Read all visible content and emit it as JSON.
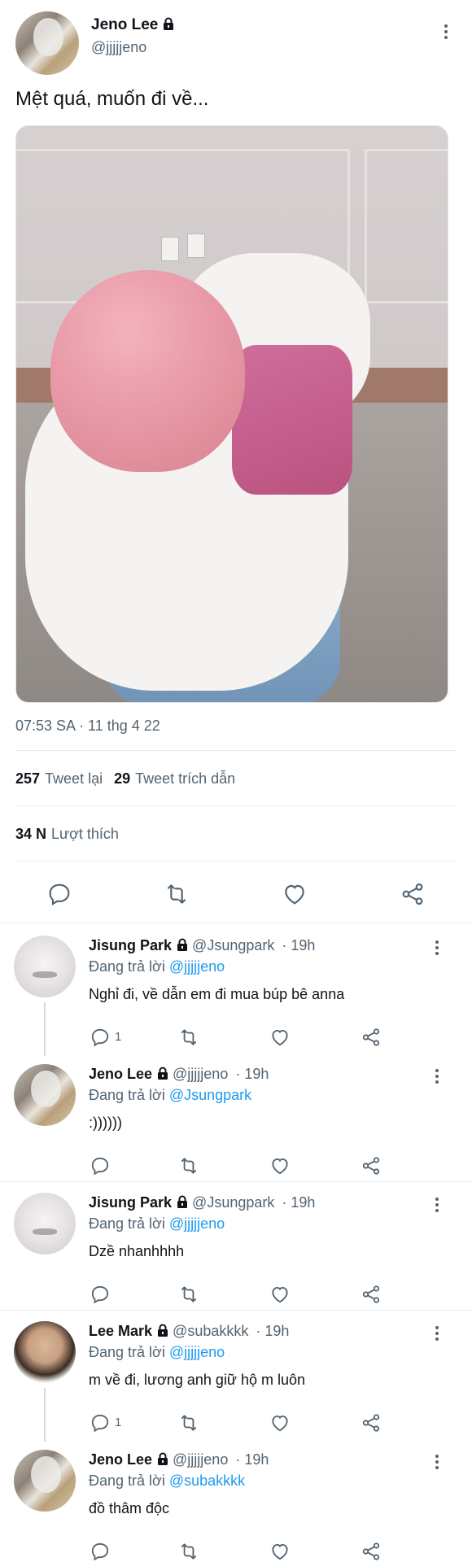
{
  "tweet": {
    "author_name": "Jeno Lee",
    "author_handle": "@jjjjjeno",
    "text": "Mệt quá, muốn đi về...",
    "timestamp": "07:53 SA · 11 thg 4 22",
    "retweets_count": "257",
    "retweets_label": "Tweet lại",
    "quotes_count": "29",
    "quotes_label": "Tweet trích dẫn",
    "likes_count": "34 N",
    "likes_label": "Lượt thích",
    "icons": [
      "reply-icon",
      "retweet-icon",
      "like-icon",
      "share-icon"
    ]
  },
  "replies": [
    {
      "name": "Jisung Park",
      "handle": "@Jsungpark",
      "time": "· 19h",
      "replying_label": "Đang trả lời",
      "replying_to": "@jjjjjeno",
      "text": "Nghỉ đi, về dẫn em đi mua búp bê anna",
      "reply_count": "1"
    },
    {
      "name": "Jeno Lee",
      "handle": "@jjjjjeno",
      "time": "· 19h",
      "replying_label": "Đang trả lời",
      "replying_to": "@Jsungpark",
      "text": ":))))))",
      "reply_count": ""
    },
    {
      "name": "Jisung Park",
      "handle": "@Jsungpark",
      "time": "· 19h",
      "replying_label": "Đang trả lời",
      "replying_to": "@jjjjjeno",
      "text": "Dzề nhanhhhh",
      "reply_count": ""
    },
    {
      "name": "Lee Mark",
      "handle": "@subakkkk",
      "time": "· 19h",
      "replying_label": "Đang trả lời",
      "replying_to": "@jjjjjeno",
      "text": "m về đi, lương anh giữ hộ m luôn",
      "reply_count": "1"
    },
    {
      "name": "Jeno Lee",
      "handle": "@jjjjjeno",
      "time": "· 19h",
      "replying_label": "Đang trả lời",
      "replying_to": "@subakkkk",
      "text": "đồ thâm độc",
      "reply_count": ""
    }
  ],
  "colors": {
    "link": "#1d9bf0",
    "secondary_text": "#536471",
    "primary_text": "#0f1419"
  }
}
